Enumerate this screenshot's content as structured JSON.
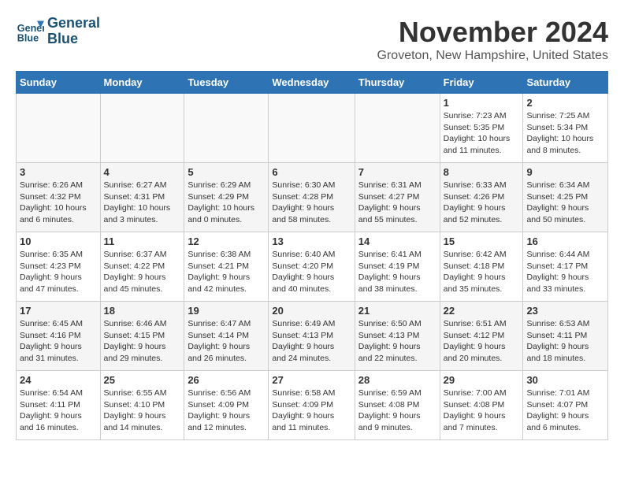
{
  "header": {
    "logo_line1": "General",
    "logo_line2": "Blue",
    "month_title": "November 2024",
    "location": "Groveton, New Hampshire, United States"
  },
  "weekdays": [
    "Sunday",
    "Monday",
    "Tuesday",
    "Wednesday",
    "Thursday",
    "Friday",
    "Saturday"
  ],
  "weeks": [
    [
      {
        "day": "",
        "info": ""
      },
      {
        "day": "",
        "info": ""
      },
      {
        "day": "",
        "info": ""
      },
      {
        "day": "",
        "info": ""
      },
      {
        "day": "",
        "info": ""
      },
      {
        "day": "1",
        "info": "Sunrise: 7:23 AM\nSunset: 5:35 PM\nDaylight: 10 hours\nand 11 minutes."
      },
      {
        "day": "2",
        "info": "Sunrise: 7:25 AM\nSunset: 5:34 PM\nDaylight: 10 hours\nand 8 minutes."
      }
    ],
    [
      {
        "day": "3",
        "info": "Sunrise: 6:26 AM\nSunset: 4:32 PM\nDaylight: 10 hours\nand 6 minutes."
      },
      {
        "day": "4",
        "info": "Sunrise: 6:27 AM\nSunset: 4:31 PM\nDaylight: 10 hours\nand 3 minutes."
      },
      {
        "day": "5",
        "info": "Sunrise: 6:29 AM\nSunset: 4:29 PM\nDaylight: 10 hours\nand 0 minutes."
      },
      {
        "day": "6",
        "info": "Sunrise: 6:30 AM\nSunset: 4:28 PM\nDaylight: 9 hours\nand 58 minutes."
      },
      {
        "day": "7",
        "info": "Sunrise: 6:31 AM\nSunset: 4:27 PM\nDaylight: 9 hours\nand 55 minutes."
      },
      {
        "day": "8",
        "info": "Sunrise: 6:33 AM\nSunset: 4:26 PM\nDaylight: 9 hours\nand 52 minutes."
      },
      {
        "day": "9",
        "info": "Sunrise: 6:34 AM\nSunset: 4:25 PM\nDaylight: 9 hours\nand 50 minutes."
      }
    ],
    [
      {
        "day": "10",
        "info": "Sunrise: 6:35 AM\nSunset: 4:23 PM\nDaylight: 9 hours\nand 47 minutes."
      },
      {
        "day": "11",
        "info": "Sunrise: 6:37 AM\nSunset: 4:22 PM\nDaylight: 9 hours\nand 45 minutes."
      },
      {
        "day": "12",
        "info": "Sunrise: 6:38 AM\nSunset: 4:21 PM\nDaylight: 9 hours\nand 42 minutes."
      },
      {
        "day": "13",
        "info": "Sunrise: 6:40 AM\nSunset: 4:20 PM\nDaylight: 9 hours\nand 40 minutes."
      },
      {
        "day": "14",
        "info": "Sunrise: 6:41 AM\nSunset: 4:19 PM\nDaylight: 9 hours\nand 38 minutes."
      },
      {
        "day": "15",
        "info": "Sunrise: 6:42 AM\nSunset: 4:18 PM\nDaylight: 9 hours\nand 35 minutes."
      },
      {
        "day": "16",
        "info": "Sunrise: 6:44 AM\nSunset: 4:17 PM\nDaylight: 9 hours\nand 33 minutes."
      }
    ],
    [
      {
        "day": "17",
        "info": "Sunrise: 6:45 AM\nSunset: 4:16 PM\nDaylight: 9 hours\nand 31 minutes."
      },
      {
        "day": "18",
        "info": "Sunrise: 6:46 AM\nSunset: 4:15 PM\nDaylight: 9 hours\nand 29 minutes."
      },
      {
        "day": "19",
        "info": "Sunrise: 6:47 AM\nSunset: 4:14 PM\nDaylight: 9 hours\nand 26 minutes."
      },
      {
        "day": "20",
        "info": "Sunrise: 6:49 AM\nSunset: 4:13 PM\nDaylight: 9 hours\nand 24 minutes."
      },
      {
        "day": "21",
        "info": "Sunrise: 6:50 AM\nSunset: 4:13 PM\nDaylight: 9 hours\nand 22 minutes."
      },
      {
        "day": "22",
        "info": "Sunrise: 6:51 AM\nSunset: 4:12 PM\nDaylight: 9 hours\nand 20 minutes."
      },
      {
        "day": "23",
        "info": "Sunrise: 6:53 AM\nSunset: 4:11 PM\nDaylight: 9 hours\nand 18 minutes."
      }
    ],
    [
      {
        "day": "24",
        "info": "Sunrise: 6:54 AM\nSunset: 4:11 PM\nDaylight: 9 hours\nand 16 minutes."
      },
      {
        "day": "25",
        "info": "Sunrise: 6:55 AM\nSunset: 4:10 PM\nDaylight: 9 hours\nand 14 minutes."
      },
      {
        "day": "26",
        "info": "Sunrise: 6:56 AM\nSunset: 4:09 PM\nDaylight: 9 hours\nand 12 minutes."
      },
      {
        "day": "27",
        "info": "Sunrise: 6:58 AM\nSunset: 4:09 PM\nDaylight: 9 hours\nand 11 minutes."
      },
      {
        "day": "28",
        "info": "Sunrise: 6:59 AM\nSunset: 4:08 PM\nDaylight: 9 hours\nand 9 minutes."
      },
      {
        "day": "29",
        "info": "Sunrise: 7:00 AM\nSunset: 4:08 PM\nDaylight: 9 hours\nand 7 minutes."
      },
      {
        "day": "30",
        "info": "Sunrise: 7:01 AM\nSunset: 4:07 PM\nDaylight: 9 hours\nand 6 minutes."
      }
    ]
  ]
}
